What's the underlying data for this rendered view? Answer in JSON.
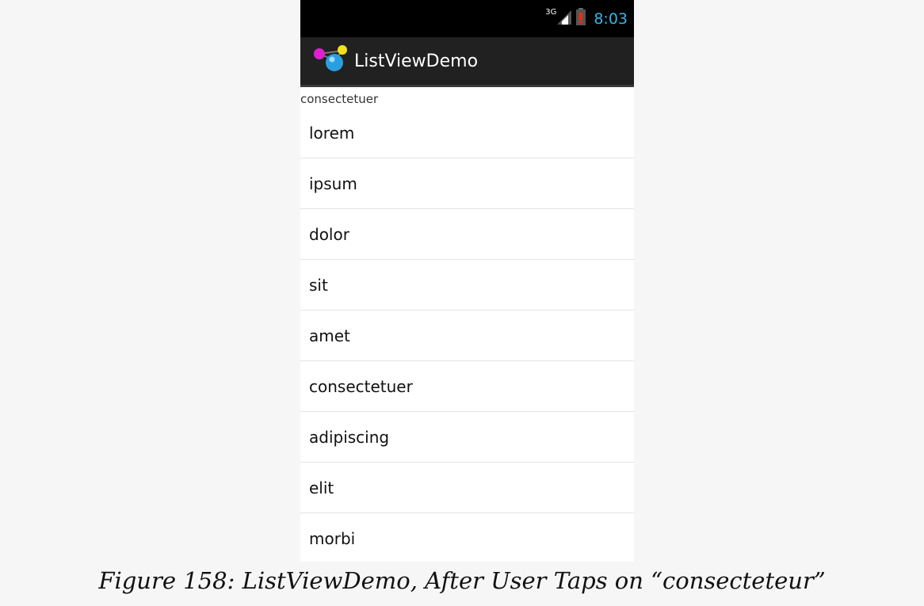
{
  "status_bar": {
    "network_type": "3G",
    "time": "8:03",
    "signal_icon": "signal-icon",
    "battery_icon": "battery-low-icon",
    "clock_color": "#33b5e5"
  },
  "action_bar": {
    "app_icon": "app-logo-icon",
    "title": "ListViewDemo"
  },
  "selection": "consectetuer",
  "list_items": [
    "lorem",
    "ipsum",
    "dolor",
    "sit",
    "amet",
    "consectetuer",
    "adipiscing",
    "elit",
    "morbi"
  ],
  "caption": "Figure 158: ListViewDemo, After User Taps on “consecteteur”"
}
